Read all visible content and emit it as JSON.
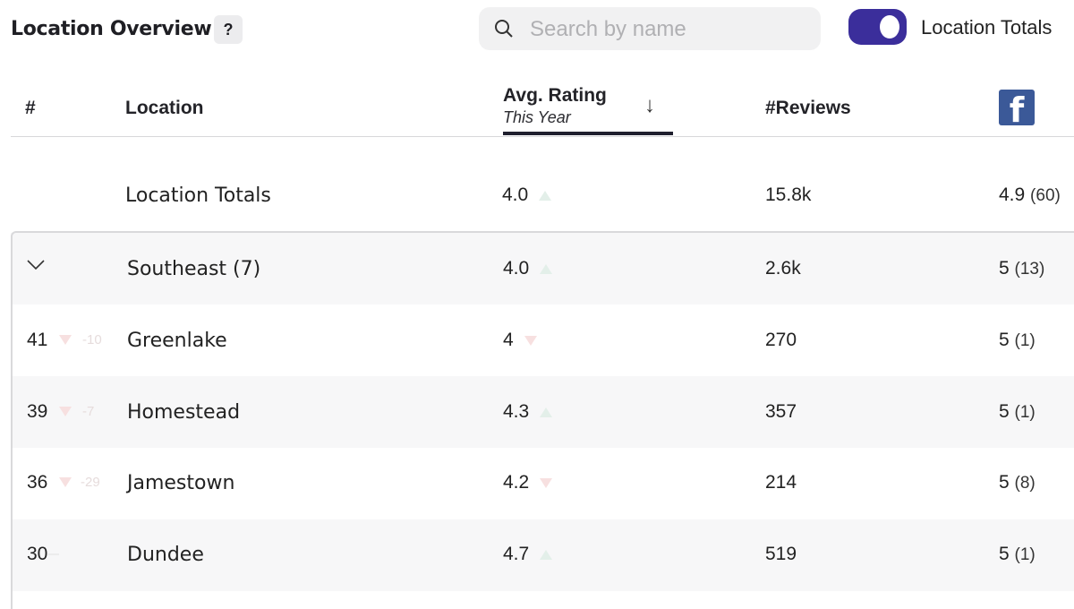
{
  "header": {
    "title": "Location Overview",
    "help_label": "?",
    "search_placeholder": "Search by name",
    "toggle_label": "Location Totals",
    "toggle_on": true
  },
  "columns": {
    "rank": "#",
    "location": "Location",
    "rating": "Avg. Rating",
    "rating_sub": "This Year",
    "sort_arrow": "↓",
    "reviews": "#Reviews",
    "facebook_icon": "f"
  },
  "totals": {
    "name": "Location Totals",
    "rating": "4.0",
    "rating_trend": "up",
    "reviews": "15.8k",
    "fb_rating": "4.9",
    "fb_count": "(60)"
  },
  "group": {
    "name": "Southeast (7)",
    "rating": "4.0",
    "rating_trend": "up",
    "reviews": "2.6k",
    "fb_rating": "5",
    "fb_count": "(13)"
  },
  "rows": [
    {
      "rank": "41",
      "rank_trend": "down",
      "rank_delta": "-10",
      "name": "Greenlake",
      "rating": "4",
      "rating_trend": "down",
      "reviews": "270",
      "fb_rating": "5",
      "fb_count": "(1)"
    },
    {
      "rank": "39",
      "rank_trend": "down",
      "rank_delta": "-7",
      "name": "Homestead",
      "rating": "4.3",
      "rating_trend": "up",
      "reviews": "357",
      "fb_rating": "5",
      "fb_count": "(1)"
    },
    {
      "rank": "36",
      "rank_trend": "down",
      "rank_delta": "-29",
      "name": "Jamestown",
      "rating": "4.2",
      "rating_trend": "down",
      "reviews": "214",
      "fb_rating": "5",
      "fb_count": "(8)"
    },
    {
      "rank": "30",
      "rank_trend": "flat",
      "rank_delta": "",
      "name": "Dundee",
      "rating": "4.7",
      "rating_trend": "up",
      "reviews": "519",
      "fb_rating": "5",
      "fb_count": "(1)"
    }
  ],
  "colors": {
    "toggle": "#3b2e9b",
    "facebook": "#3b5998",
    "trend_up": "#e3efe9",
    "trend_down": "#f7e0e0"
  }
}
